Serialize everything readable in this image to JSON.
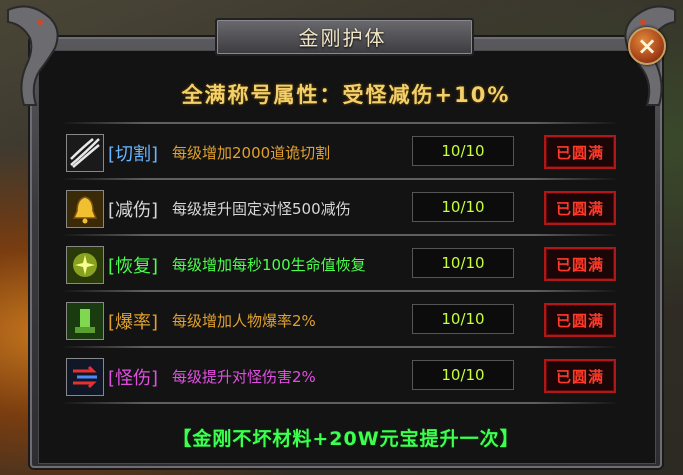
{
  "window": {
    "title": "金刚护体",
    "close_icon": "close-x-icon"
  },
  "headline": "全满称号属性：受怪减伤+10%",
  "rows": [
    {
      "label": "[切割]",
      "desc": "每级增加2000道诡切割",
      "progress": "10/10",
      "status": "已圆满",
      "label_color": "#68b4ff",
      "desc_color": "#e0a030",
      "icon": "slash-icon"
    },
    {
      "label": "[减伤]",
      "desc": "每级提升固定对怪500减伤",
      "progress": "10/10",
      "status": "已圆满",
      "label_color": "#d8d8d8",
      "desc_color": "#d8d8d8",
      "icon": "bell-icon"
    },
    {
      "label": "[恢复]",
      "desc": "每级增加每秒100生命值恢复",
      "progress": "10/10",
      "status": "已圆满",
      "label_color": "#4cff4c",
      "desc_color": "#4cff4c",
      "icon": "heal-icon"
    },
    {
      "label": "[爆率]",
      "desc": "每级增加人物爆率2%",
      "progress": "10/10",
      "status": "已圆满",
      "label_color": "#e0a030",
      "desc_color": "#e0a030",
      "icon": "drop-rate-icon"
    },
    {
      "label": "[怪伤]",
      "desc": "每级提升对怪伤害2%",
      "progress": "10/10",
      "status": "已圆满",
      "label_color": "#e050e0",
      "desc_color": "#e050e0",
      "icon": "monster-damage-icon"
    }
  ],
  "footer": "【金刚不坏材料+20W元宝提升一次】"
}
